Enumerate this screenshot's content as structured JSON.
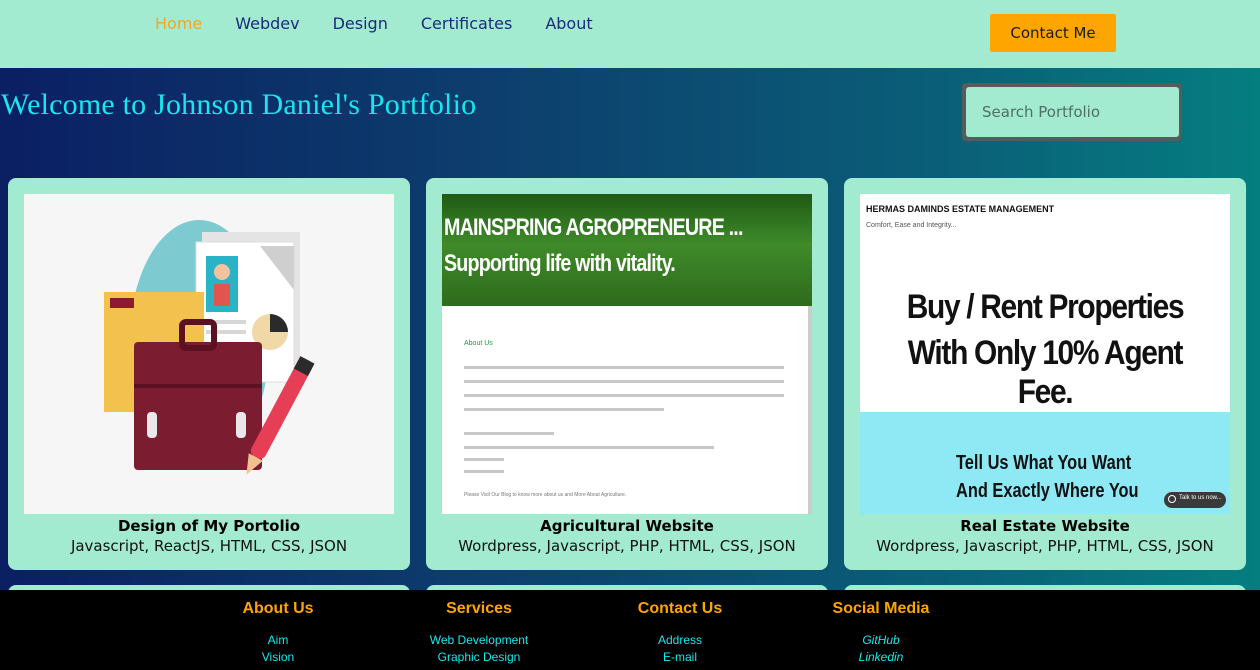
{
  "nav": {
    "items": [
      "Home",
      "Webdev",
      "Design",
      "Certificates",
      "About"
    ],
    "contact_label": "Contact Me"
  },
  "hero": {
    "title": "Welcome to Johnson Daniel's Portfolio"
  },
  "search": {
    "placeholder": "Search Portfolio"
  },
  "cards": [
    {
      "title": "Design of My Portolio",
      "tags": "Javascript, ReactJS, HTML, CSS, JSON"
    },
    {
      "title": "Agricultural Website",
      "tags": "Wordpress, Javascript, PHP, HTML, CSS, JSON",
      "thumb": {
        "banner_line1": "MAINSPRING AGROPRENEURE ...",
        "banner_line2": "Supporting life with vitality.",
        "link": "About Us",
        "bottom_text": "Please Visit Our Blog to know more about us and More About Agriculture."
      }
    },
    {
      "title": "Real Estate Website",
      "tags": "Wordpress, Javascript, PHP, HTML, CSS, JSON",
      "thumb": {
        "brand": "HERMAS DAMINDS ESTATE MANAGEMENT",
        "tagline": "Comfort, Ease and Integrity...",
        "headline1": "Buy / Rent Properties",
        "headline2": "With Only 10% Agent Fee.",
        "sub1": "Tell Us What You Want",
        "sub2": "And Exactly Where You",
        "chat": "Talk to us now..."
      }
    }
  ],
  "footer": {
    "about": {
      "heading": "About Us",
      "links": [
        "Aim",
        "Vision"
      ]
    },
    "services": {
      "heading": "Services",
      "links": [
        "Web Development",
        "Graphic Design"
      ]
    },
    "contact": {
      "heading": "Contact Us",
      "links": [
        "Address",
        "E-mail"
      ]
    },
    "social": {
      "heading": "Social Media",
      "links": [
        "GitHub",
        "Linkedin"
      ]
    }
  },
  "colors": {
    "accent": "#ffa500",
    "mint": "#a2ebd0",
    "cyan_text": "#19e6f0",
    "nav_text": "#1b2a7a"
  }
}
